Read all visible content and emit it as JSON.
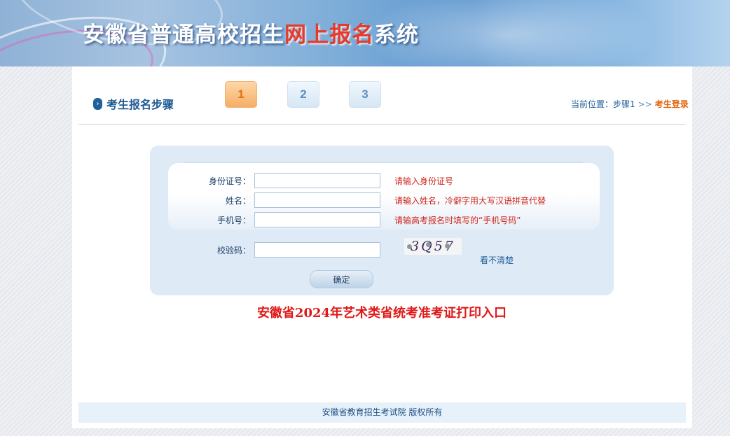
{
  "banner": {
    "title_part1": "安徽省普通高校招生",
    "title_highlight": "网上报名",
    "title_part2": "系统"
  },
  "steps": {
    "title": "考生报名步骤",
    "items": [
      "1",
      "2",
      "3"
    ],
    "active_index": 0
  },
  "breadcrumb": {
    "prefix": "当前位置：步骤1",
    "separator": ">>",
    "current": "考生登录"
  },
  "form": {
    "id_label": "身份证号：",
    "id_value": "",
    "id_hint": "请输入身份证号",
    "name_label": "姓名：",
    "name_value": "",
    "name_hint": "请输入姓名，冷僻字用大写汉语拼音代替",
    "phone_label": "手机号：",
    "phone_value": "",
    "phone_hint": "请输高考报名时填写的“手机号码”",
    "captcha_label": "校验码：",
    "captcha_value": "",
    "captcha_text": "3Q57",
    "refresh_label": "看不清楚",
    "submit_label": "确定"
  },
  "print_link": "安徽省2024年艺术类省统考准考证打印入口",
  "footer": "安徽省教育招生考试院  版权所有",
  "colors": {
    "accent_blue": "#1f5a94",
    "hint_red": "#d0241b",
    "active_step": "#f5ad62",
    "link_red": "#e01919"
  }
}
